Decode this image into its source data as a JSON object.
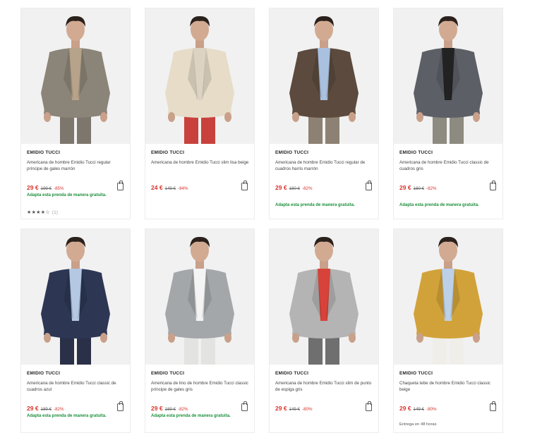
{
  "products": [
    {
      "brand": "EMIDIO TUCCI",
      "title": "Americana de hombre Emidio Tucci regular príncipe de gales marrón",
      "price": "29 €",
      "old_price": "199 €",
      "discount": "-85%",
      "adapt": "Adapta esta prenda de manera gratuita.",
      "rating_stars": "★★★★☆",
      "rating_count": "(1)",
      "jacket_color": "#8b8478",
      "pants_color": "#7d766c",
      "inner_color": "#b7a38a",
      "icon": "shopping-bag-icon"
    },
    {
      "brand": "EMIDIO TUCCI",
      "title": "Americana de hombre Emidio Tucci slim lisa beige",
      "price": "24 €",
      "old_price": "149 €",
      "discount": "-84%",
      "jacket_color": "#e6dcc8",
      "pants_color": "#c8413c",
      "inner_color": "#dcd3c2",
      "icon": "shopping-bag-icon"
    },
    {
      "brand": "EMIDIO TUCCI",
      "title": "Americana de hombre Emidio Tucci regular de cuadros harris marrón",
      "price": "29 €",
      "old_price": "180 €",
      "discount": "-82%",
      "adapt": "Adapta esta prenda de manera gratuita.",
      "jacket_color": "#5b4a3d",
      "pants_color": "#8c8172",
      "inner_color": "#a9c1df",
      "icon": "shopping-bag-icon"
    },
    {
      "brand": "EMIDIO TUCCI",
      "title": "Americana de hombre Emidio Tucci classic de cuadros gris",
      "price": "29 €",
      "old_price": "180 €",
      "discount": "-82%",
      "adapt": "Adapta esta prenda de manera gratuita.",
      "jacket_color": "#5c5f66",
      "pants_color": "#8d8a80",
      "inner_color": "#222222",
      "icon": "shopping-bag-icon"
    },
    {
      "brand": "EMIDIO TUCCI",
      "title": "Americana de hombre Emidio Tucci classic de cuadros azul",
      "price": "29 €",
      "old_price": "189 €",
      "discount": "-82%",
      "adapt": "Adapta esta prenda de manera gratuita.",
      "jacket_color": "#2d3754",
      "pants_color": "#2a3048",
      "inner_color": "#b4c7e3",
      "icon": "shopping-bag-icon"
    },
    {
      "brand": "EMIDIO TUCCI",
      "title": "Americana de lino de hombre Emidio Tucci classic príncipe de gales gris",
      "price": "29 €",
      "old_price": "189 €",
      "discount": "-82%",
      "adapt": "Adapta esta prenda de manera gratuita.",
      "jacket_color": "#a4a7a9",
      "pants_color": "#e3e3e1",
      "inner_color": "#f4f4f4",
      "icon": "shopping-bag-icon"
    },
    {
      "brand": "EMIDIO TUCCI",
      "title": "Americana de hombre Emidio Tucci slim de punto de espiga gris",
      "price": "29 €",
      "old_price": "149 €",
      "discount": "-80%",
      "jacket_color": "#b4b4b4",
      "pants_color": "#6f6f6f",
      "inner_color": "#d7423a",
      "icon": "shopping-bag-icon"
    },
    {
      "brand": "EMIDIO TUCCI",
      "title": "Chaqueta tebe de hombre Emidio Tucci classic beige",
      "price": "29 €",
      "old_price": "149 €",
      "discount": "-80%",
      "delivery": "Entrega en 48 horas",
      "jacket_color": "#d2a23a",
      "pants_color": "#f0eee8",
      "inner_color": "#bcd0e8",
      "icon": "shopping-bag-icon"
    }
  ]
}
